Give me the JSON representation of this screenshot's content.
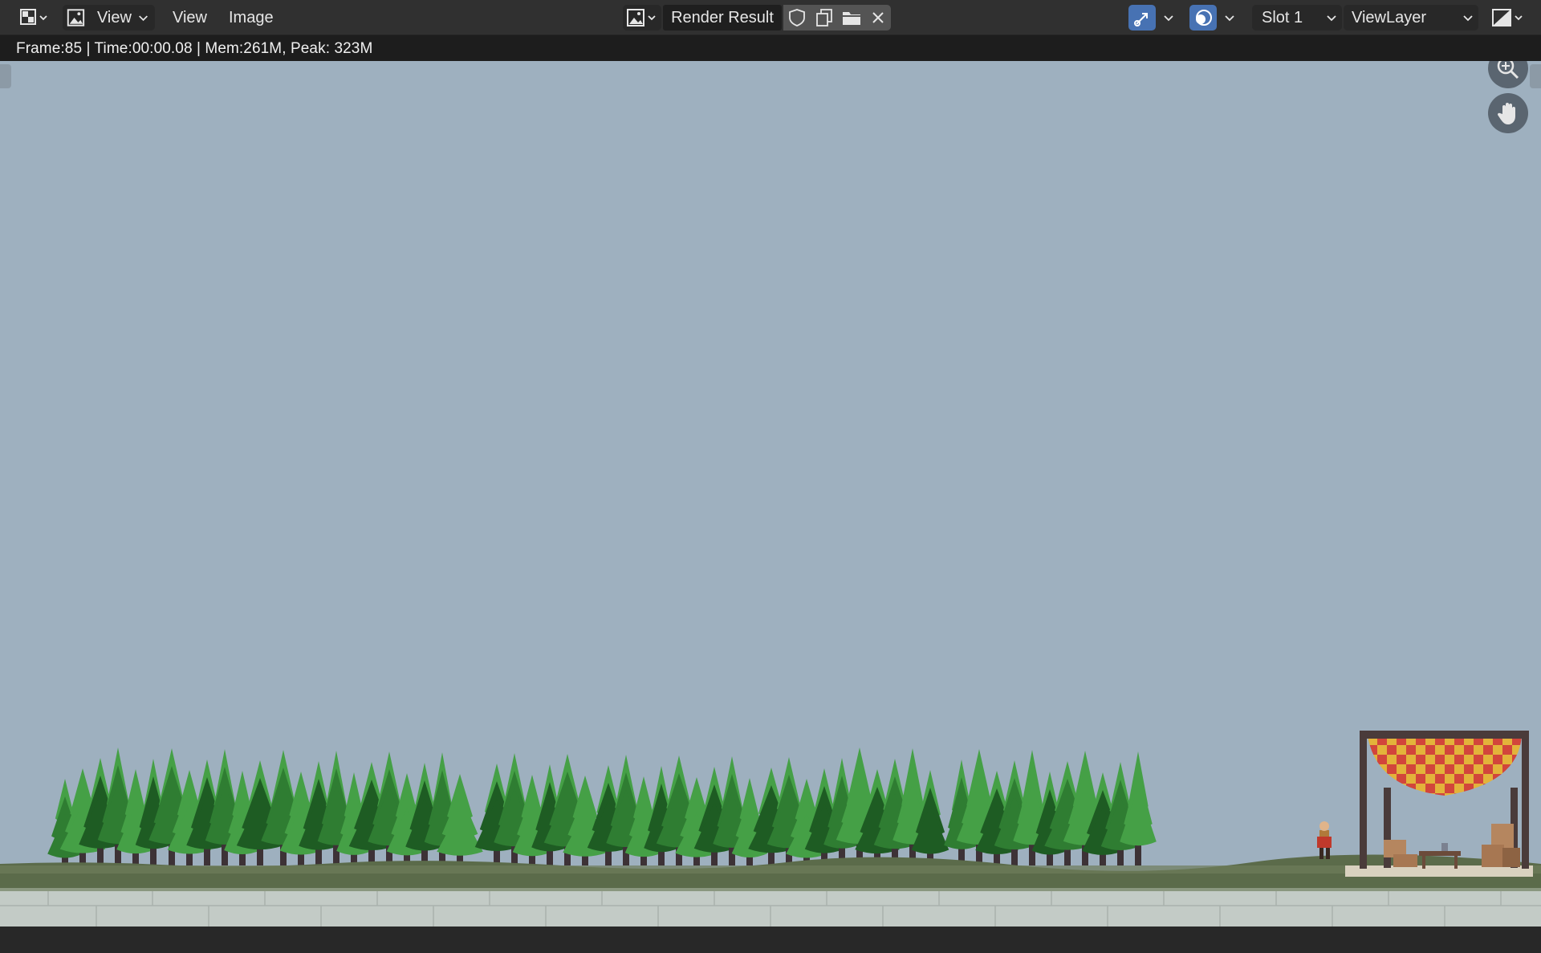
{
  "header": {
    "editor_type_icon": "image-editor-icon",
    "mode_icon": "view-mode-icon",
    "mode_label": "View",
    "menus": [
      "View",
      "Image"
    ],
    "image_browse_icon": "image-browse-icon",
    "image_name": "Render Result",
    "fake_user_icon": "shield-icon",
    "duplicate_icon": "duplicate-icon",
    "open_icon": "folder-icon",
    "unlink_icon": "close-icon",
    "gizmo_icon": "gizmo-icon",
    "overlay_icon": "overlay-icon",
    "slot_label": "Slot 1",
    "layer_label": "ViewLayer",
    "display_channels_icon": "display-channels-icon",
    "accent": "#4772b3"
  },
  "info": {
    "text": "Frame:85 | Time:00:00.08 | Mem:261M, Peak: 323M"
  },
  "navigation": {
    "zoom_icon": "zoom-icon",
    "pan_icon": "hand-icon"
  },
  "scene": {
    "sky_color": "#9eb0bf",
    "ground_color": "#5b6b4a",
    "stone_color": "#c3cbc6",
    "tree_colors": [
      "#2f7d32",
      "#45a046",
      "#1e5c23"
    ]
  }
}
